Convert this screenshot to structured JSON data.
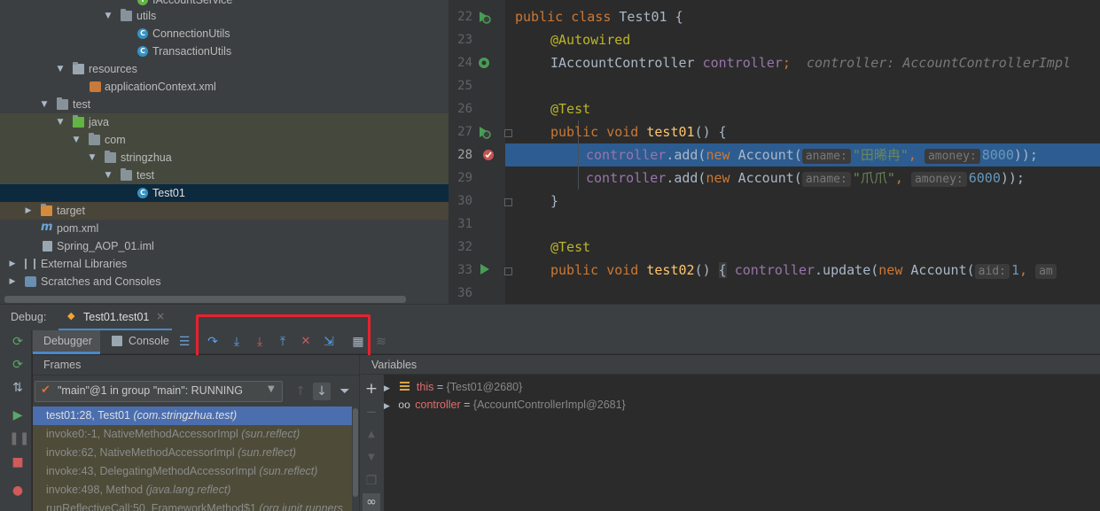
{
  "project_tree": {
    "items": [
      {
        "label": "IAccountService",
        "kind": "interface"
      },
      {
        "label": "utils",
        "kind": "package"
      },
      {
        "label": "ConnectionUtils",
        "kind": "class"
      },
      {
        "label": "TransactionUtils",
        "kind": "class"
      },
      {
        "label": "resources",
        "kind": "resources-folder"
      },
      {
        "label": "applicationContext.xml",
        "kind": "xml"
      },
      {
        "label": "test",
        "kind": "folder"
      },
      {
        "label": "java",
        "kind": "test-source-folder"
      },
      {
        "label": "com",
        "kind": "package"
      },
      {
        "label": "stringzhua",
        "kind": "package"
      },
      {
        "label": "test",
        "kind": "package"
      },
      {
        "label": "Test01",
        "kind": "test-class"
      },
      {
        "label": "target",
        "kind": "excluded-folder"
      },
      {
        "label": "pom.xml",
        "kind": "maven"
      },
      {
        "label": "Spring_AOP_01.iml",
        "kind": "iml"
      },
      {
        "label": "External Libraries",
        "kind": "libraries"
      },
      {
        "label": "Scratches and Consoles",
        "kind": "scratches"
      }
    ]
  },
  "editor": {
    "line_numbers": [
      "22",
      "23",
      "24",
      "25",
      "26",
      "27",
      "28",
      "29",
      "30",
      "31",
      "32",
      "33",
      "36"
    ],
    "current_line": "28",
    "code": {
      "l22_kw": "public class",
      "l22_name": " Test01 {",
      "l23_ann": "@Autowired",
      "l24_type": "IAccountController ",
      "l24_field": "controller",
      "l24_semi": ";",
      "l24_inline": "controller: AccountControllerImpl",
      "l26_ann": "@Test",
      "l27_kw": "public void ",
      "l27_fn": "test01",
      "l27_rest": "() {",
      "l28_field": "controller",
      "l28_call": ".add(",
      "l28_new": "new",
      "l28_cls": " Account(",
      "l28_hint1": "aname:",
      "l28_str": "\"田晞冉\"",
      "l28_comma": ", ",
      "l28_hint2": "amoney:",
      "l28_num": "8000",
      "l28_end": "));",
      "l29_field": "controller",
      "l29_call": ".add(",
      "l29_new": "new",
      "l29_cls": " Account(",
      "l29_hint1": "aname:",
      "l29_str": "\"爪爪\"",
      "l29_comma": ", ",
      "l29_hint2": "amoney:",
      "l29_num": "6000",
      "l29_end": "));",
      "l30": "}",
      "l32_ann": "@Test",
      "l33_kw": "public void ",
      "l33_fn": "test02",
      "l33_a": "() ",
      "l33_brace": "{",
      "l33_field": " controller",
      "l33_call": ".update(",
      "l33_new": "new",
      "l33_cls": " Account(",
      "l33_hint1": "aid:",
      "l33_num": "1",
      "l33_comma": ", ",
      "l33_hint2": "am"
    }
  },
  "debug": {
    "label": "Debug:",
    "session_tab": "Test01.test01",
    "tabs": [
      "Debugger",
      "Console"
    ],
    "frames_title": "Frames",
    "variables_title": "Variables",
    "thread_select": "\"main\"@1 in group \"main\": RUNNING",
    "frames": [
      {
        "method": "test01:28, Test01",
        "pkg": "(com.stringzhua.test)",
        "selected": true
      },
      {
        "method": "invoke0:-1, NativeMethodAccessorImpl",
        "pkg": "(sun.reflect)",
        "selected": false
      },
      {
        "method": "invoke:62, NativeMethodAccessorImpl",
        "pkg": "(sun.reflect)",
        "selected": false
      },
      {
        "method": "invoke:43, DelegatingMethodAccessorImpl",
        "pkg": "(sun.reflect)",
        "selected": false
      },
      {
        "method": "invoke:498, Method",
        "pkg": "(java.lang.reflect)",
        "selected": false
      },
      {
        "method": "runReflectiveCall:50, FrameworkMethod$1",
        "pkg": "(org.junit.runners",
        "selected": false
      }
    ],
    "variables": [
      {
        "name": "this",
        "value": "{Test01@2680}",
        "icon": "field-icon"
      },
      {
        "name": "controller",
        "value": "{AccountControllerImpl@2681}",
        "icon": "watch-icon"
      }
    ]
  },
  "colors": {
    "accent_highlight": "#2d5c91",
    "red_box": "#e8212d",
    "frame_selected": "#4b6eaf"
  }
}
